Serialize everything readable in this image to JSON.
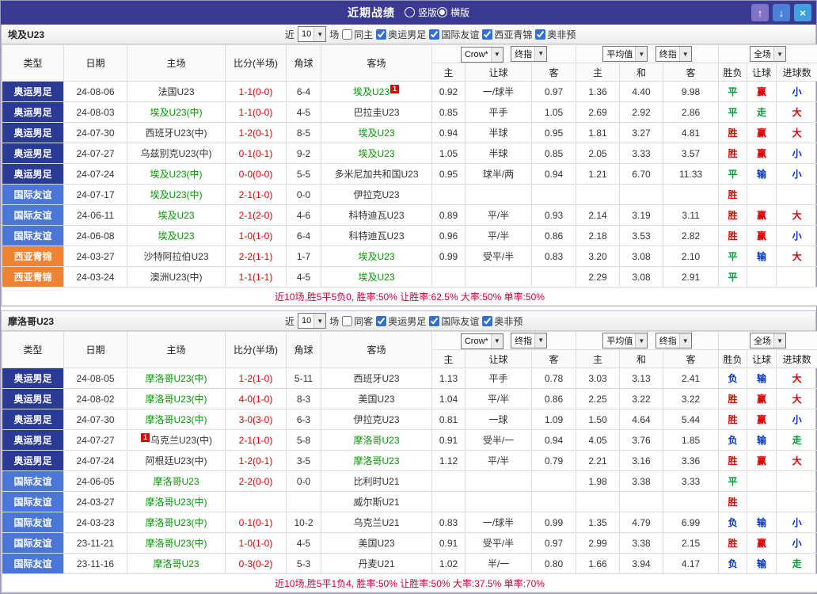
{
  "colors": {
    "titlebar_bg": "#3b3a92",
    "type_olympic": "#2b3a94",
    "type_friendly": "#4a76d8",
    "type_wasia": "#f08332",
    "focal_team": "#009900",
    "score": "#e60000",
    "win": "#dd0000",
    "draw": "#009933",
    "lose": "#0033cc",
    "footer_text": "#cc0033"
  },
  "titlebar": {
    "title": "近期战绩",
    "layout_options": [
      {
        "label": "竖版",
        "selected": false
      },
      {
        "label": "横版",
        "selected": true
      }
    ],
    "buttons": {
      "up": "↑",
      "down": "↓",
      "close": "×"
    }
  },
  "sections": [
    {
      "team": "埃及U23",
      "filters": {
        "near": "近",
        "count": "10",
        "games": "场",
        "same": {
          "label": "同主",
          "checked": false
        },
        "leagues": [
          {
            "label": "奥运男足",
            "checked": true
          },
          {
            "label": "国际友谊",
            "checked": true
          },
          {
            "label": "西亚青锦",
            "checked": true
          },
          {
            "label": "奥非预",
            "checked": true
          }
        ]
      },
      "selects": {
        "bookmaker": "Crow*",
        "final_a": "终指",
        "average": "平均值",
        "final_b": "终指",
        "scope": "全场"
      },
      "headers": {
        "type": "类型",
        "date": "日期",
        "home": "主场",
        "score": "比分(半场)",
        "corner": "角球",
        "away": "客场",
        "odds_home": "主",
        "odds_handicap": "让球",
        "odds_away": "客",
        "avg_home": "主",
        "avg_draw": "和",
        "avg_away": "客",
        "result": "胜负",
        "handicap_result": "让球",
        "goals": "进球数"
      },
      "rows": [
        {
          "type": "奥运男足",
          "date": "24-08-06",
          "home": "法国U23",
          "home_focal": false,
          "home_card": "",
          "score": "1-1(0-0)",
          "corner": "6-4",
          "away": "埃及U23",
          "away_focal": true,
          "away_card": "1",
          "odds": [
            "0.92",
            "一/球半",
            "0.97"
          ],
          "avg": [
            "1.36",
            "4.40",
            "9.98"
          ],
          "result": "平",
          "handicap": "赢",
          "goals": "小"
        },
        {
          "type": "奥运男足",
          "date": "24-08-03",
          "home": "埃及U23(中)",
          "home_focal": true,
          "home_card": "",
          "score": "1-1(0-0)",
          "corner": "4-5",
          "away": "巴拉圭U23",
          "away_focal": false,
          "away_card": "",
          "odds": [
            "0.85",
            "平手",
            "1.05"
          ],
          "avg": [
            "2.69",
            "2.92",
            "2.86"
          ],
          "result": "平",
          "handicap": "走",
          "goals": "大"
        },
        {
          "type": "奥运男足",
          "date": "24-07-30",
          "home": "西班牙U23(中)",
          "home_focal": false,
          "home_card": "",
          "score": "1-2(0-1)",
          "corner": "8-5",
          "away": "埃及U23",
          "away_focal": true,
          "away_card": "",
          "odds": [
            "0.94",
            "半球",
            "0.95"
          ],
          "avg": [
            "1.81",
            "3.27",
            "4.81"
          ],
          "result": "胜",
          "handicap": "赢",
          "goals": "大"
        },
        {
          "type": "奥运男足",
          "date": "24-07-27",
          "home": "乌兹别克U23(中)",
          "home_focal": false,
          "home_card": "",
          "score": "0-1(0-1)",
          "corner": "9-2",
          "away": "埃及U23",
          "away_focal": true,
          "away_card": "",
          "odds": [
            "1.05",
            "半球",
            "0.85"
          ],
          "avg": [
            "2.05",
            "3.33",
            "3.57"
          ],
          "result": "胜",
          "handicap": "赢",
          "goals": "小"
        },
        {
          "type": "奥运男足",
          "date": "24-07-24",
          "home": "埃及U23(中)",
          "home_focal": true,
          "home_card": "",
          "score": "0-0(0-0)",
          "corner": "5-5",
          "away": "多米尼加共和国U23",
          "away_focal": false,
          "away_card": "",
          "odds": [
            "0.95",
            "球半/两",
            "0.94"
          ],
          "avg": [
            "1.21",
            "6.70",
            "11.33"
          ],
          "result": "平",
          "handicap": "输",
          "goals": "小"
        },
        {
          "type": "国际友谊",
          "date": "24-07-17",
          "home": "埃及U23(中)",
          "home_focal": true,
          "home_card": "",
          "score": "2-1(1-0)",
          "corner": "0-0",
          "away": "伊拉克U23",
          "away_focal": false,
          "away_card": "",
          "odds": [
            "",
            "",
            ""
          ],
          "avg": [
            "",
            "",
            ""
          ],
          "result": "胜",
          "handicap": "",
          "goals": ""
        },
        {
          "type": "国际友谊",
          "date": "24-06-11",
          "home": "埃及U23",
          "home_focal": true,
          "home_card": "",
          "score": "2-1(2-0)",
          "corner": "4-6",
          "away": "科特迪瓦U23",
          "away_focal": false,
          "away_card": "",
          "odds": [
            "0.89",
            "平/半",
            "0.93"
          ],
          "avg": [
            "2.14",
            "3.19",
            "3.11"
          ],
          "result": "胜",
          "handicap": "赢",
          "goals": "大"
        },
        {
          "type": "国际友谊",
          "date": "24-06-08",
          "home": "埃及U23",
          "home_focal": true,
          "home_card": "",
          "score": "1-0(1-0)",
          "corner": "6-4",
          "away": "科特迪瓦U23",
          "away_focal": false,
          "away_card": "",
          "odds": [
            "0.96",
            "平/半",
            "0.86"
          ],
          "avg": [
            "2.18",
            "3.53",
            "2.82"
          ],
          "result": "胜",
          "handicap": "赢",
          "goals": "小"
        },
        {
          "type": "西亚青锦",
          "date": "24-03-27",
          "home": "沙特阿拉伯U23",
          "home_focal": false,
          "home_card": "",
          "score": "2-2(1-1)",
          "corner": "1-7",
          "away": "埃及U23",
          "away_focal": true,
          "away_card": "",
          "odds": [
            "0.99",
            "受平/半",
            "0.83"
          ],
          "avg": [
            "3.20",
            "3.08",
            "2.10"
          ],
          "result": "平",
          "handicap": "输",
          "goals": "大"
        },
        {
          "type": "西亚青锦",
          "date": "24-03-24",
          "home": "澳洲U23(中)",
          "home_focal": false,
          "home_card": "",
          "score": "1-1(1-1)",
          "corner": "4-5",
          "away": "埃及U23",
          "away_focal": true,
          "away_card": "",
          "odds": [
            "",
            "",
            ""
          ],
          "avg": [
            "2.29",
            "3.08",
            "2.91"
          ],
          "result": "平",
          "handicap": "",
          "goals": ""
        }
      ],
      "summary": "近10场,胜5平5负0, 胜率:50% 让胜率:62.5% 大率:50% 单率:50%"
    },
    {
      "team": "摩洛哥U23",
      "filters": {
        "near": "近",
        "count": "10",
        "games": "场",
        "same": {
          "label": "同客",
          "checked": false
        },
        "leagues": [
          {
            "label": "奥运男足",
            "checked": true
          },
          {
            "label": "国际友谊",
            "checked": true
          },
          {
            "label": "奥非预",
            "checked": true
          }
        ]
      },
      "selects": {
        "bookmaker": "Crow*",
        "final_a": "终指",
        "average": "平均值",
        "final_b": "终指",
        "scope": "全场"
      },
      "headers": {
        "type": "类型",
        "date": "日期",
        "home": "主场",
        "score": "比分(半场)",
        "corner": "角球",
        "away": "客场",
        "odds_home": "主",
        "odds_handicap": "让球",
        "odds_away": "客",
        "avg_home": "主",
        "avg_draw": "和",
        "avg_away": "客",
        "result": "胜负",
        "handicap_result": "让球",
        "goals": "进球数"
      },
      "rows": [
        {
          "type": "奥运男足",
          "date": "24-08-05",
          "home": "摩洛哥U23(中)",
          "home_focal": true,
          "home_card": "",
          "score": "1-2(1-0)",
          "corner": "5-11",
          "away": "西班牙U23",
          "away_focal": false,
          "away_card": "",
          "odds": [
            "1.13",
            "平手",
            "0.78"
          ],
          "avg": [
            "3.03",
            "3.13",
            "2.41"
          ],
          "result": "负",
          "handicap": "输",
          "goals": "大"
        },
        {
          "type": "奥运男足",
          "date": "24-08-02",
          "home": "摩洛哥U23(中)",
          "home_focal": true,
          "home_card": "",
          "score": "4-0(1-0)",
          "corner": "8-3",
          "away": "美国U23",
          "away_focal": false,
          "away_card": "",
          "odds": [
            "1.04",
            "平/半",
            "0.86"
          ],
          "avg": [
            "2.25",
            "3.22",
            "3.22"
          ],
          "result": "胜",
          "handicap": "赢",
          "goals": "大"
        },
        {
          "type": "奥运男足",
          "date": "24-07-30",
          "home": "摩洛哥U23(中)",
          "home_focal": true,
          "home_card": "",
          "score": "3-0(3-0)",
          "corner": "6-3",
          "away": "伊拉克U23",
          "away_focal": false,
          "away_card": "",
          "odds": [
            "0.81",
            "一球",
            "1.09"
          ],
          "avg": [
            "1.50",
            "4.64",
            "5.44"
          ],
          "result": "胜",
          "handicap": "赢",
          "goals": "小"
        },
        {
          "type": "奥运男足",
          "date": "24-07-27",
          "home": "乌克兰U23(中)",
          "home_focal": false,
          "home_card": "1",
          "score": "2-1(1-0)",
          "corner": "5-8",
          "away": "摩洛哥U23",
          "away_focal": true,
          "away_card": "",
          "odds": [
            "0.91",
            "受半/一",
            "0.94"
          ],
          "avg": [
            "4.05",
            "3.76",
            "1.85"
          ],
          "result": "负",
          "handicap": "输",
          "goals": "走"
        },
        {
          "type": "奥运男足",
          "date": "24-07-24",
          "home": "阿根廷U23(中)",
          "home_focal": false,
          "home_card": "",
          "score": "1-2(0-1)",
          "corner": "3-5",
          "away": "摩洛哥U23",
          "away_focal": true,
          "away_card": "",
          "odds": [
            "1.12",
            "平/半",
            "0.79"
          ],
          "avg": [
            "2.21",
            "3.16",
            "3.36"
          ],
          "result": "胜",
          "handicap": "赢",
          "goals": "大"
        },
        {
          "type": "国际友谊",
          "date": "24-06-05",
          "home": "摩洛哥U23",
          "home_focal": true,
          "home_card": "",
          "score": "2-2(0-0)",
          "corner": "0-0",
          "away": "比利时U21",
          "away_focal": false,
          "away_card": "",
          "odds": [
            "",
            "",
            ""
          ],
          "avg": [
            "1.98",
            "3.38",
            "3.33"
          ],
          "result": "平",
          "handicap": "",
          "goals": ""
        },
        {
          "type": "国际友谊",
          "date": "24-03-27",
          "home": "摩洛哥U23(中)",
          "home_focal": true,
          "home_card": "",
          "score": "",
          "corner": "",
          "away": "威尔斯U21",
          "away_focal": false,
          "away_card": "",
          "odds": [
            "",
            "",
            ""
          ],
          "avg": [
            "",
            "",
            ""
          ],
          "result": "胜",
          "handicap": "",
          "goals": ""
        },
        {
          "type": "国际友谊",
          "date": "24-03-23",
          "home": "摩洛哥U23(中)",
          "home_focal": true,
          "home_card": "",
          "score": "0-1(0-1)",
          "corner": "10-2",
          "away": "乌克兰U21",
          "away_focal": false,
          "away_card": "",
          "odds": [
            "0.83",
            "一/球半",
            "0.99"
          ],
          "avg": [
            "1.35",
            "4.79",
            "6.99"
          ],
          "result": "负",
          "handicap": "输",
          "goals": "小"
        },
        {
          "type": "国际友谊",
          "date": "23-11-21",
          "home": "摩洛哥U23(中)",
          "home_focal": true,
          "home_card": "",
          "score": "1-0(1-0)",
          "corner": "4-5",
          "away": "美国U23",
          "away_focal": false,
          "away_card": "",
          "odds": [
            "0.91",
            "受平/半",
            "0.97"
          ],
          "avg": [
            "2.99",
            "3.38",
            "2.15"
          ],
          "result": "胜",
          "handicap": "赢",
          "goals": "小"
        },
        {
          "type": "国际友谊",
          "date": "23-11-16",
          "home": "摩洛哥U23",
          "home_focal": true,
          "home_card": "",
          "score": "0-3(0-2)",
          "corner": "5-3",
          "away": "丹麦U21",
          "away_focal": false,
          "away_card": "",
          "odds": [
            "1.02",
            "半/一",
            "0.80"
          ],
          "avg": [
            "1.66",
            "3.94",
            "4.17"
          ],
          "result": "负",
          "handicap": "输",
          "goals": "走"
        }
      ],
      "summary": "近10场,胜5平1负4, 胜率:50% 让胜率:50% 大率:37.5% 单率:70%"
    }
  ]
}
